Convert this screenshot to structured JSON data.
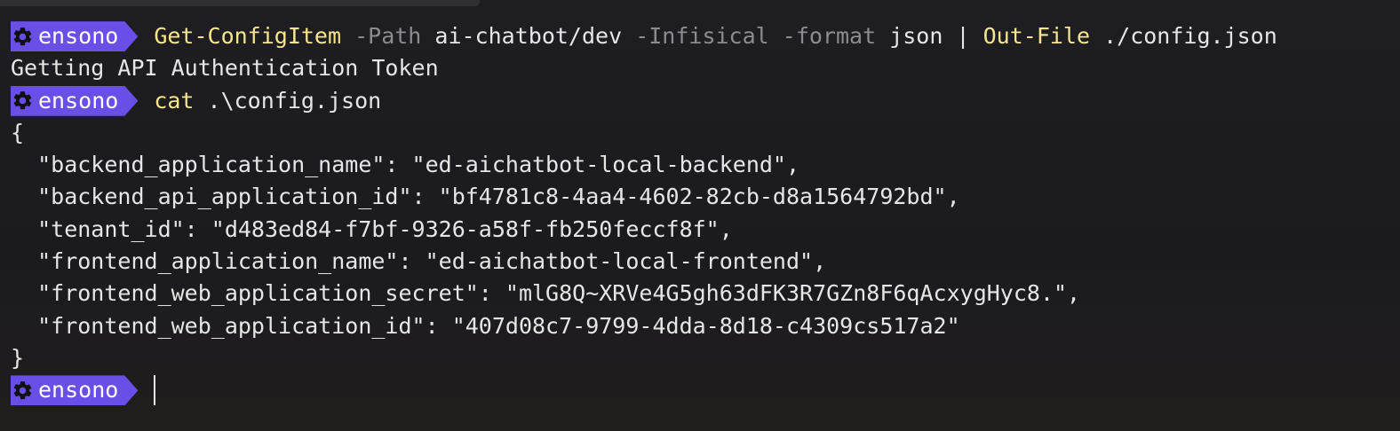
{
  "window": {
    "title": ""
  },
  "prompt": {
    "label": "ensono",
    "icon": "gear-icon",
    "color": "#6a4fe6"
  },
  "command1": {
    "cmd": "Get-ConfigItem",
    "param_path": "-Path",
    "path_value": "ai-chatbot/dev",
    "param_infisical": "-Infisical",
    "param_format": "-format",
    "format_value": "json",
    "pipe": "|",
    "cmd2": "Out-File",
    "out_value": "./config.json"
  },
  "output1": "Getting API Authentication Token",
  "command2": {
    "cmd": "cat",
    "arg": ".\\config.json"
  },
  "json_output": {
    "open": "{",
    "lines": [
      "  \"backend_application_name\": \"ed-aichatbot-local-backend\",",
      "  \"backend_api_application_id\": \"bf4781c8-4aa4-4602-82cb-d8a1564792bd\",",
      "  \"tenant_id\": \"d483ed84-f7bf-9326-a58f-fb250feccf8f\",",
      "  \"frontend_application_name\": \"ed-aichatbot-local-frontend\",",
      "  \"frontend_web_application_secret\": \"mlG8Q~XRVe4G5gh63dFK3R7GZn8F6qAcxygHyc8.\",",
      "  \"frontend_web_application_id\": \"407d08c7-9799-4dda-8d18-c4309cs517a2\""
    ],
    "close": "}"
  },
  "colors": {
    "command": "#f6e58d",
    "parameter": "#8c8c8c",
    "text": "#e6e6e6",
    "background": "#1b1b1f"
  }
}
